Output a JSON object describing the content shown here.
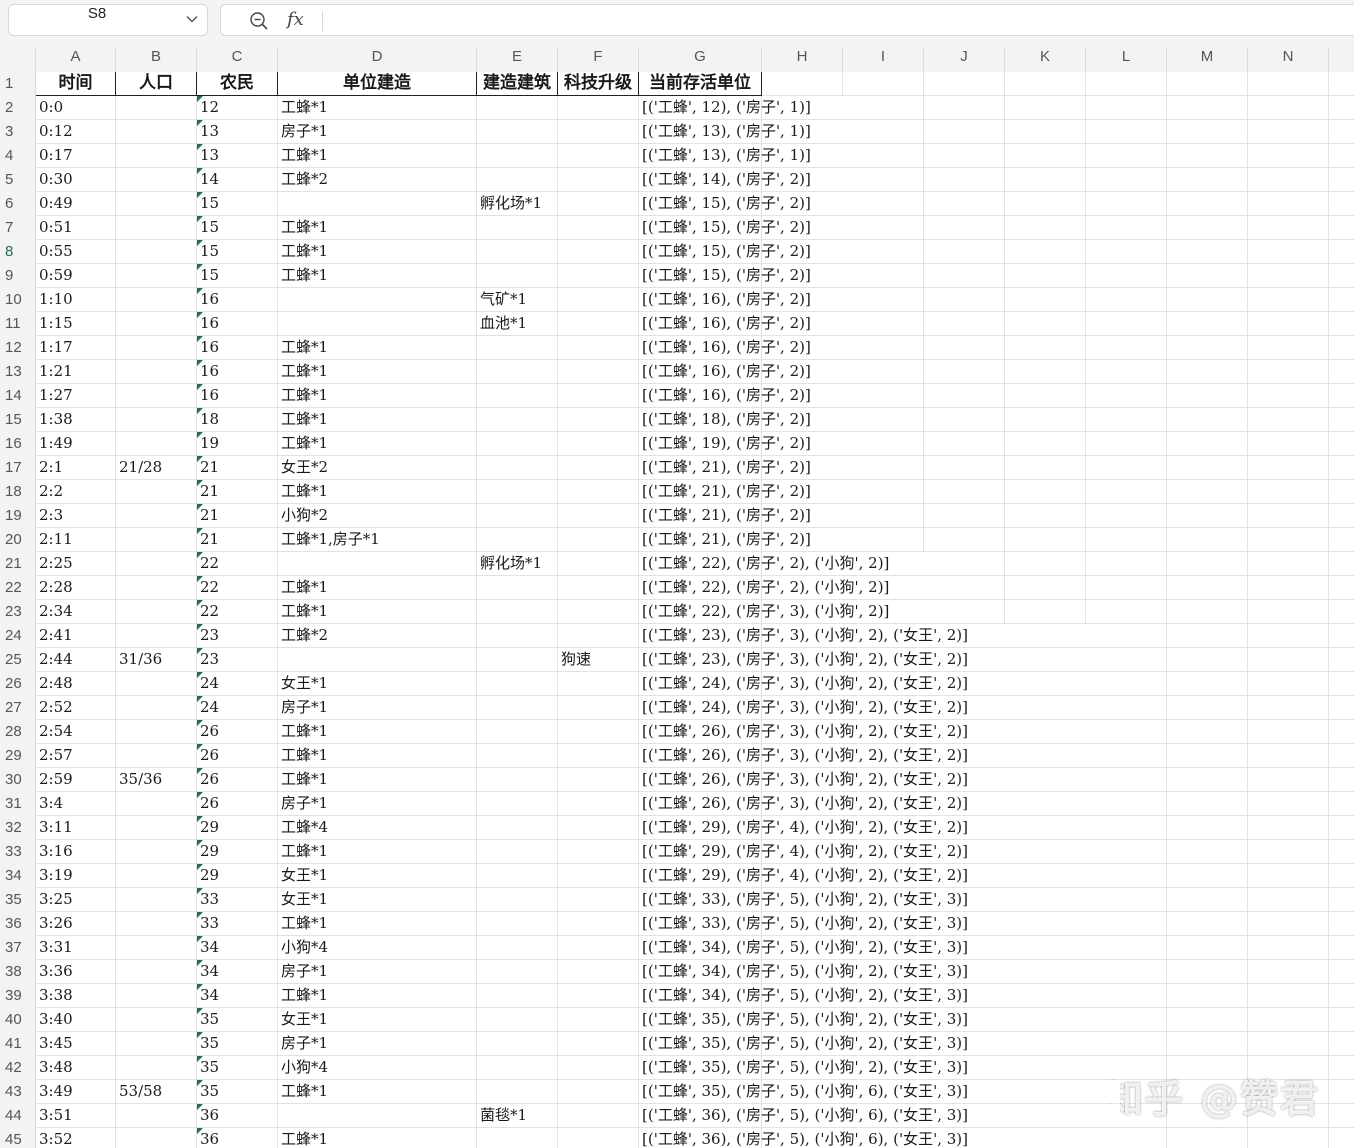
{
  "toolbar": {
    "name_box": "S8",
    "fx_label": "fx",
    "formula": ""
  },
  "column_letters": [
    "A",
    "B",
    "C",
    "D",
    "E",
    "F",
    "G",
    "H",
    "I",
    "J",
    "K",
    "L",
    "M",
    "N"
  ],
  "header_row": {
    "row_number": "1",
    "A": "时间",
    "B": "人口",
    "C": "农民",
    "D": "单位建造",
    "E": "建造建筑",
    "F": "科技升级",
    "G": "当前存活单位"
  },
  "selected_row": "8",
  "rows": [
    {
      "n": "2",
      "A": "0:0",
      "B": "",
      "C": "12",
      "D": "工蜂*1",
      "E": "",
      "F": "",
      "G": "[('工蜂', 12), ('房子', 1)]"
    },
    {
      "n": "3",
      "A": "0:12",
      "B": "",
      "C": "13",
      "D": "房子*1",
      "E": "",
      "F": "",
      "G": "[('工蜂', 13), ('房子', 1)]"
    },
    {
      "n": "4",
      "A": "0:17",
      "B": "",
      "C": "13",
      "D": "工蜂*1",
      "E": "",
      "F": "",
      "G": "[('工蜂', 13), ('房子', 1)]"
    },
    {
      "n": "5",
      "A": "0:30",
      "B": "",
      "C": "14",
      "D": "工蜂*2",
      "E": "",
      "F": "",
      "G": "[('工蜂', 14), ('房子', 2)]"
    },
    {
      "n": "6",
      "A": "0:49",
      "B": "",
      "C": "15",
      "D": "",
      "E": "孵化场*1",
      "F": "",
      "G": "[('工蜂', 15), ('房子', 2)]"
    },
    {
      "n": "7",
      "A": "0:51",
      "B": "",
      "C": "15",
      "D": "工蜂*1",
      "E": "",
      "F": "",
      "G": "[('工蜂', 15), ('房子', 2)]"
    },
    {
      "n": "8",
      "A": "0:55",
      "B": "",
      "C": "15",
      "D": "工蜂*1",
      "E": "",
      "F": "",
      "G": "[('工蜂', 15), ('房子', 2)]"
    },
    {
      "n": "9",
      "A": "0:59",
      "B": "",
      "C": "15",
      "D": "工蜂*1",
      "E": "",
      "F": "",
      "G": "[('工蜂', 15), ('房子', 2)]"
    },
    {
      "n": "10",
      "A": "1:10",
      "B": "",
      "C": "16",
      "D": "",
      "E": "气矿*1",
      "F": "",
      "G": "[('工蜂', 16), ('房子', 2)]"
    },
    {
      "n": "11",
      "A": "1:15",
      "B": "",
      "C": "16",
      "D": "",
      "E": "血池*1",
      "F": "",
      "G": "[('工蜂', 16), ('房子', 2)]"
    },
    {
      "n": "12",
      "A": "1:17",
      "B": "",
      "C": "16",
      "D": "工蜂*1",
      "E": "",
      "F": "",
      "G": "[('工蜂', 16), ('房子', 2)]"
    },
    {
      "n": "13",
      "A": "1:21",
      "B": "",
      "C": "16",
      "D": "工蜂*1",
      "E": "",
      "F": "",
      "G": "[('工蜂', 16), ('房子', 2)]"
    },
    {
      "n": "14",
      "A": "1:27",
      "B": "",
      "C": "16",
      "D": "工蜂*1",
      "E": "",
      "F": "",
      "G": "[('工蜂', 16), ('房子', 2)]"
    },
    {
      "n": "15",
      "A": "1:38",
      "B": "",
      "C": "18",
      "D": "工蜂*1",
      "E": "",
      "F": "",
      "G": "[('工蜂', 18), ('房子', 2)]"
    },
    {
      "n": "16",
      "A": "1:49",
      "B": "",
      "C": "19",
      "D": "工蜂*1",
      "E": "",
      "F": "",
      "G": "[('工蜂', 19), ('房子', 2)]"
    },
    {
      "n": "17",
      "A": "2:1",
      "B": "21/28",
      "C": "21",
      "D": "女王*2",
      "E": "",
      "F": "",
      "G": "[('工蜂', 21), ('房子', 2)]"
    },
    {
      "n": "18",
      "A": "2:2",
      "B": "",
      "C": "21",
      "D": "工蜂*1",
      "E": "",
      "F": "",
      "G": "[('工蜂', 21), ('房子', 2)]"
    },
    {
      "n": "19",
      "A": "2:3",
      "B": "",
      "C": "21",
      "D": "小狗*2",
      "E": "",
      "F": "",
      "G": "[('工蜂', 21), ('房子', 2)]"
    },
    {
      "n": "20",
      "A": "2:11",
      "B": "",
      "C": "21",
      "D": "工蜂*1,房子*1",
      "E": "",
      "F": "",
      "G": "[('工蜂', 21), ('房子', 2)]"
    },
    {
      "n": "21",
      "A": "2:25",
      "B": "",
      "C": "22",
      "D": "",
      "E": "孵化场*1",
      "F": "",
      "G": "[('工蜂', 22), ('房子', 2), ('小狗', 2)]"
    },
    {
      "n": "22",
      "A": "2:28",
      "B": "",
      "C": "22",
      "D": "工蜂*1",
      "E": "",
      "F": "",
      "G": "[('工蜂', 22), ('房子', 2), ('小狗', 2)]"
    },
    {
      "n": "23",
      "A": "2:34",
      "B": "",
      "C": "22",
      "D": "工蜂*1",
      "E": "",
      "F": "",
      "G": "[('工蜂', 22), ('房子', 3), ('小狗', 2)]"
    },
    {
      "n": "24",
      "A": "2:41",
      "B": "",
      "C": "23",
      "D": "工蜂*2",
      "E": "",
      "F": "",
      "G": "[('工蜂', 23), ('房子', 3), ('小狗', 2), ('女王', 2)]"
    },
    {
      "n": "25",
      "A": "2:44",
      "B": "31/36",
      "C": "23",
      "D": "",
      "E": "",
      "F": "狗速",
      "G": "[('工蜂', 23), ('房子', 3), ('小狗', 2), ('女王', 2)]"
    },
    {
      "n": "26",
      "A": "2:48",
      "B": "",
      "C": "24",
      "D": "女王*1",
      "E": "",
      "F": "",
      "G": "[('工蜂', 24), ('房子', 3), ('小狗', 2), ('女王', 2)]"
    },
    {
      "n": "27",
      "A": "2:52",
      "B": "",
      "C": "24",
      "D": "房子*1",
      "E": "",
      "F": "",
      "G": "[('工蜂', 24), ('房子', 3), ('小狗', 2), ('女王', 2)]"
    },
    {
      "n": "28",
      "A": "2:54",
      "B": "",
      "C": "26",
      "D": "工蜂*1",
      "E": "",
      "F": "",
      "G": "[('工蜂', 26), ('房子', 3), ('小狗', 2), ('女王', 2)]"
    },
    {
      "n": "29",
      "A": "2:57",
      "B": "",
      "C": "26",
      "D": "工蜂*1",
      "E": "",
      "F": "",
      "G": "[('工蜂', 26), ('房子', 3), ('小狗', 2), ('女王', 2)]"
    },
    {
      "n": "30",
      "A": "2:59",
      "B": "35/36",
      "C": "26",
      "D": "工蜂*1",
      "E": "",
      "F": "",
      "G": "[('工蜂', 26), ('房子', 3), ('小狗', 2), ('女王', 2)]"
    },
    {
      "n": "31",
      "A": "3:4",
      "B": "",
      "C": "26",
      "D": "房子*1",
      "E": "",
      "F": "",
      "G": "[('工蜂', 26), ('房子', 3), ('小狗', 2), ('女王', 2)]"
    },
    {
      "n": "32",
      "A": "3:11",
      "B": "",
      "C": "29",
      "D": "工蜂*4",
      "E": "",
      "F": "",
      "G": "[('工蜂', 29), ('房子', 4), ('小狗', 2), ('女王', 2)]"
    },
    {
      "n": "33",
      "A": "3:16",
      "B": "",
      "C": "29",
      "D": "工蜂*1",
      "E": "",
      "F": "",
      "G": "[('工蜂', 29), ('房子', 4), ('小狗', 2), ('女王', 2)]"
    },
    {
      "n": "34",
      "A": "3:19",
      "B": "",
      "C": "29",
      "D": "女王*1",
      "E": "",
      "F": "",
      "G": "[('工蜂', 29), ('房子', 4), ('小狗', 2), ('女王', 2)]"
    },
    {
      "n": "35",
      "A": "3:25",
      "B": "",
      "C": "33",
      "D": "女王*1",
      "E": "",
      "F": "",
      "G": "[('工蜂', 33), ('房子', 5), ('小狗', 2), ('女王', 3)]"
    },
    {
      "n": "36",
      "A": "3:26",
      "B": "",
      "C": "33",
      "D": "工蜂*1",
      "E": "",
      "F": "",
      "G": "[('工蜂', 33), ('房子', 5), ('小狗', 2), ('女王', 3)]"
    },
    {
      "n": "37",
      "A": "3:31",
      "B": "",
      "C": "34",
      "D": "小狗*4",
      "E": "",
      "F": "",
      "G": "[('工蜂', 34), ('房子', 5), ('小狗', 2), ('女王', 3)]"
    },
    {
      "n": "38",
      "A": "3:36",
      "B": "",
      "C": "34",
      "D": "房子*1",
      "E": "",
      "F": "",
      "G": "[('工蜂', 34), ('房子', 5), ('小狗', 2), ('女王', 3)]"
    },
    {
      "n": "39",
      "A": "3:38",
      "B": "",
      "C": "34",
      "D": "工蜂*1",
      "E": "",
      "F": "",
      "G": "[('工蜂', 34), ('房子', 5), ('小狗', 2), ('女王', 3)]"
    },
    {
      "n": "40",
      "A": "3:40",
      "B": "",
      "C": "35",
      "D": "女王*1",
      "E": "",
      "F": "",
      "G": "[('工蜂', 35), ('房子', 5), ('小狗', 2), ('女王', 3)]"
    },
    {
      "n": "41",
      "A": "3:45",
      "B": "",
      "C": "35",
      "D": "房子*1",
      "E": "",
      "F": "",
      "G": "[('工蜂', 35), ('房子', 5), ('小狗', 2), ('女王', 3)]"
    },
    {
      "n": "42",
      "A": "3:48",
      "B": "",
      "C": "35",
      "D": "小狗*4",
      "E": "",
      "F": "",
      "G": "[('工蜂', 35), ('房子', 5), ('小狗', 2), ('女王', 3)]"
    },
    {
      "n": "43",
      "A": "3:49",
      "B": "53/58",
      "C": "35",
      "D": "工蜂*1",
      "E": "",
      "F": "",
      "G": "[('工蜂', 35), ('房子', 5), ('小狗', 6), ('女王', 3)]"
    },
    {
      "n": "44",
      "A": "3:51",
      "B": "",
      "C": "36",
      "D": "",
      "E": "菌毯*1",
      "F": "",
      "G": "[('工蜂', 36), ('房子', 5), ('小狗', 6), ('女王', 3)]"
    },
    {
      "n": "45",
      "A": "3:52",
      "B": "",
      "C": "36",
      "D": "工蜂*1",
      "E": "",
      "F": "",
      "G": "[('工蜂', 36), ('房子', 5), ('小狗', 6), ('女王', 3)]"
    }
  ],
  "watermark": "知乎 @赞君",
  "accent_color": "#1e7145"
}
